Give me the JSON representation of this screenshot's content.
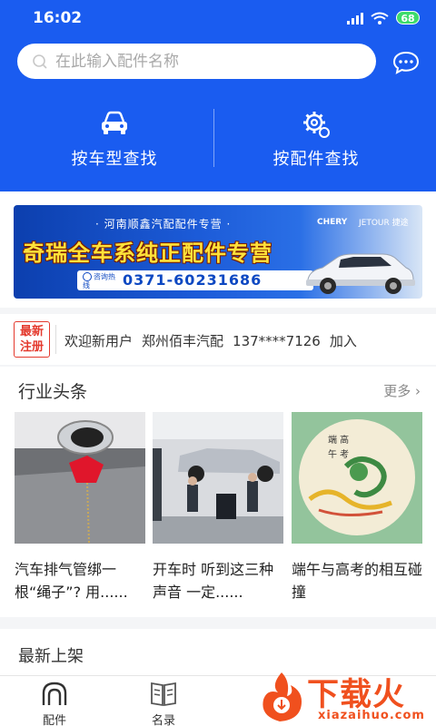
{
  "status_bar": {
    "time": "16:02",
    "battery": "68"
  },
  "search": {
    "placeholder": "在此输入配件名称"
  },
  "quick_nav": [
    {
      "label": "按车型查找",
      "icon": "car-icon"
    },
    {
      "label": "按配件查找",
      "icon": "gear-icon"
    }
  ],
  "banner": {
    "top_text": "· 河南顺鑫汽配配件专营 ·",
    "main_text": "奇瑞全车系纯正配件专营",
    "hotline_label": "咨询热线",
    "phone": "0371-60231686",
    "brand_chery": "CHERY",
    "brand_jetour": "JETOUR 捷途"
  },
  "notice": {
    "badge": "最新注册",
    "parts": [
      "欢迎新用户",
      "郑州佰丰汽配",
      "137****7126",
      "加入"
    ]
  },
  "news": {
    "title": "行业头条",
    "more": "更多",
    "items": [
      {
        "caption": "汽车排气管绑一根“绳子”? 用......"
      },
      {
        "caption": "开车时 听到这三种声音 一定......"
      },
      {
        "caption": "端午与高考的相互碰撞"
      }
    ]
  },
  "latest": {
    "title": "最新上架"
  },
  "tabbar": [
    {
      "label": "配件",
      "icon": "home-arch-icon"
    },
    {
      "label": "名录",
      "icon": "book-icon"
    }
  ],
  "watermark": {
    "text": "下载火",
    "url": "xiazaihuo.com"
  },
  "colors": {
    "primary": "#1a5cf0",
    "badge": "#e43a2e",
    "watermark": "#f0501e"
  }
}
